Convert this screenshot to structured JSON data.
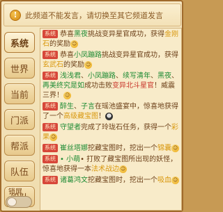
{
  "banner": {
    "icon": "info-icon",
    "text": "此频道不能发言，请切换至其它频道发言"
  },
  "tabs": [
    {
      "label": "系统",
      "active": true
    },
    {
      "label": "世界",
      "active": false
    },
    {
      "label": "当前",
      "active": false
    },
    {
      "label": "门派",
      "active": false
    },
    {
      "label": "帮派",
      "active": false
    },
    {
      "label": "队伍",
      "active": false
    },
    {
      "label": "组队",
      "active": false
    }
  ],
  "lock": {
    "label": "锁屏"
  },
  "messages": [
    {
      "tag": "系统",
      "parts": [
        "恭喜",
        "黑夜",
        "挑战变异星官成功，获得",
        "金刚石",
        "的奖励"
      ]
    },
    {
      "tag": "系统",
      "parts": [
        "恭喜",
        "小凤蹦路",
        "挑战变异星官成功，获得",
        "玄武石",
        "的奖励"
      ]
    },
    {
      "tag": "系统",
      "parts": [
        "浅浅君",
        "、",
        "小凤蹦路",
        "、",
        "续写清年",
        "、",
        "黑夜",
        "、",
        "再美终究是如",
        "成功击败",
        "变异北斗星官",
        "！威震三界！"
      ]
    },
    {
      "tag": "系统",
      "parts": [
        "醉生",
        "、",
        "子言",
        "在瑶池盛宴中，惊喜地获得了一个",
        "高级藏宝图",
        "！"
      ]
    },
    {
      "tag": "系统",
      "parts": [
        "守望者",
        "完成了玲珑石任务，获得一个",
        "彩果"
      ]
    },
    {
      "tag": "系统",
      "parts": [
        "崔丝塔娜",
        "挖藏宝图时，挖出一个",
        "锦囊"
      ]
    },
    {
      "tag": "系统",
      "parts": [
        "• 小萌",
        "• 打败了藏宝图所出现的妖怪，惊喜地获得一本",
        "法术战边"
      ]
    },
    {
      "tag": "系统",
      "parts": [
        "诸葛鸿文",
        "挖藏宝图时，挖出一个",
        "吸血"
      ]
    }
  ]
}
